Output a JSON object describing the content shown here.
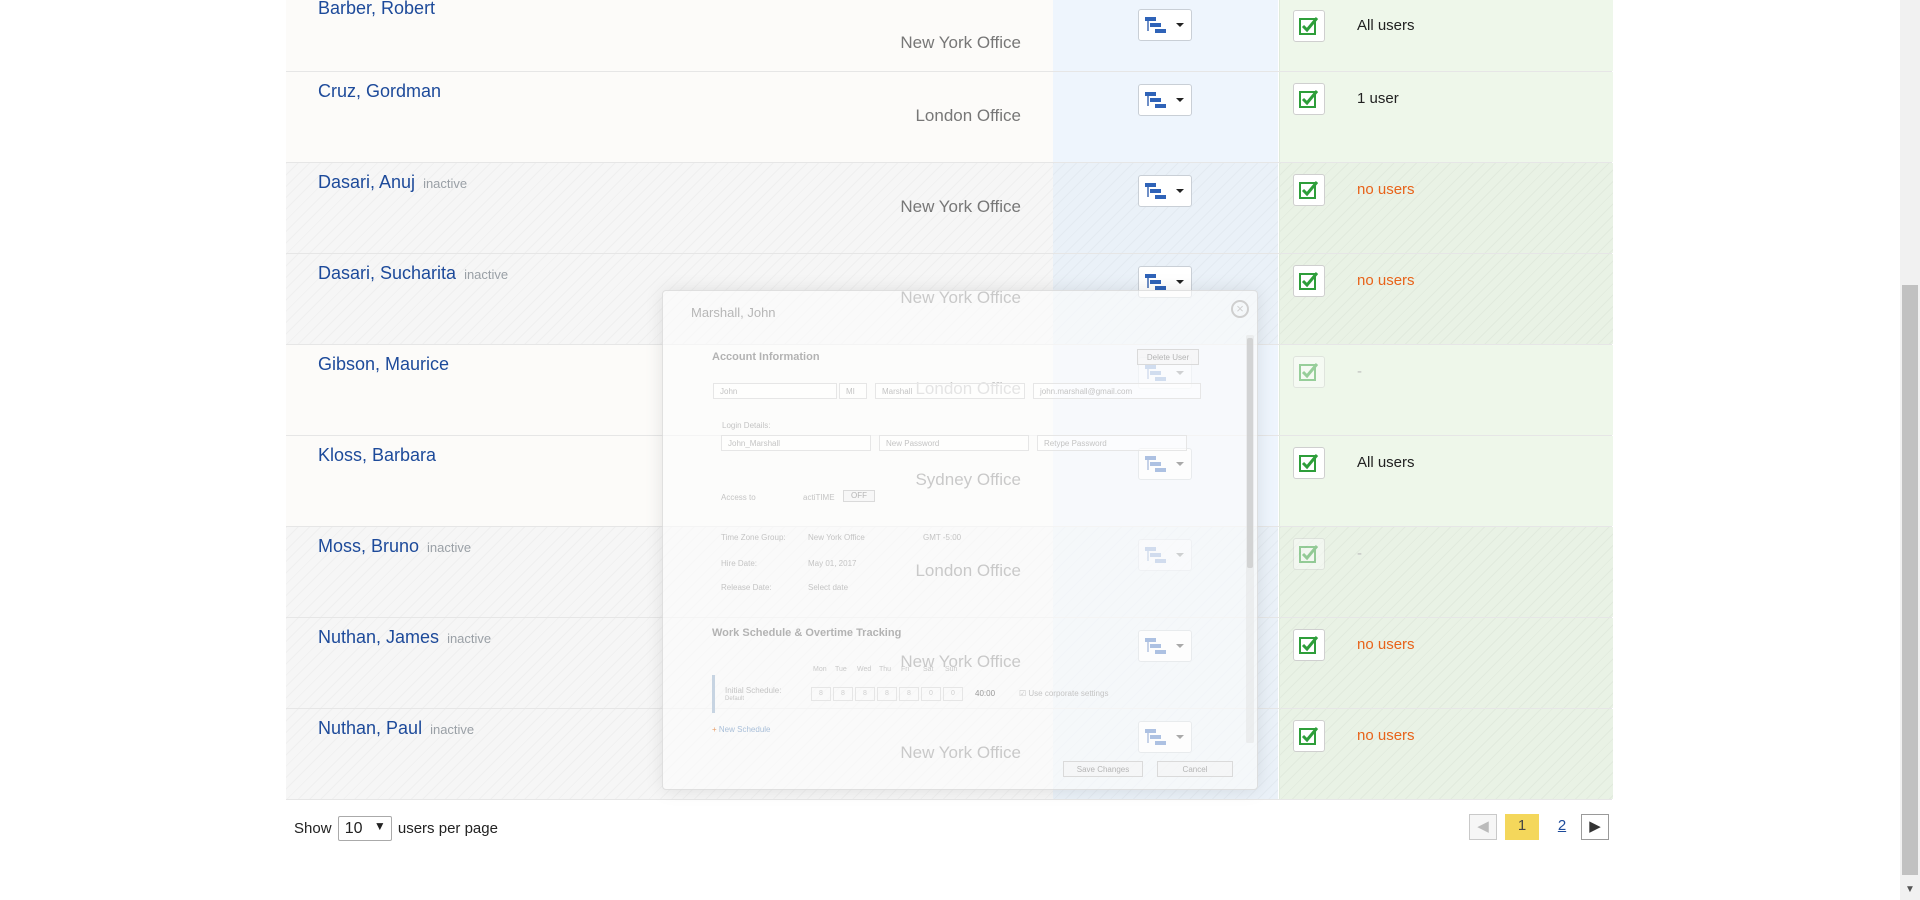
{
  "users": [
    {
      "name": "Barber, Robert",
      "status": "",
      "office": "New York Office",
      "access": "All users",
      "access_style": "normal",
      "checked": true
    },
    {
      "name": "Cruz, Gordman",
      "status": "",
      "office": "London Office",
      "access": "1 user",
      "access_style": "normal",
      "checked": true
    },
    {
      "name": "Dasari, Anuj",
      "status": "inactive",
      "office": "New York Office",
      "access": "no users",
      "access_style": "orange",
      "checked": true
    },
    {
      "name": "Dasari, Sucharita",
      "status": "inactive",
      "office": "New York Office",
      "access": "no users",
      "access_style": "orange",
      "checked": true
    },
    {
      "name": "Gibson, Maurice",
      "status": "",
      "office": "London Office",
      "access": "-",
      "access_style": "dash",
      "checked": false
    },
    {
      "name": "Kloss, Barbara",
      "status": "",
      "office": "Sydney Office",
      "access": "All users",
      "access_style": "normal",
      "checked": true
    },
    {
      "name": "Moss, Bruno",
      "status": "inactive",
      "office": "London Office",
      "access": "-",
      "access_style": "dash",
      "checked": false
    },
    {
      "name": "Nuthan, James",
      "status": "inactive",
      "office": "New York Office",
      "access": "no users",
      "access_style": "orange",
      "checked": true
    },
    {
      "name": "Nuthan, Paul",
      "status": "inactive",
      "office": "New York Office",
      "access": "no users",
      "access_style": "orange",
      "checked": true
    }
  ],
  "footer": {
    "show_label": "Show",
    "per_page_value": "10",
    "per_page_suffix": "users per page"
  },
  "pager": {
    "current": "1",
    "next_page": "2"
  },
  "modal": {
    "title": "Marshall, John",
    "account_section": "Account Information",
    "delete_label": "Delete User",
    "first_name": "John",
    "mi_placeholder": "MI",
    "last_name": "Marshall",
    "email": "john.marshall@gmail.com",
    "login_label": "Login Details:",
    "username": "John_Marshall",
    "new_password_placeholder": "New Password",
    "retype_password_placeholder": "Retype Password",
    "access_label": "Access to",
    "app_name": "actiTIME",
    "toggle_label": "OFF",
    "tz_label": "Time Zone Group:",
    "tz_value": "New York Office",
    "tz_offset": "GMT -5:00",
    "hire_label": "Hire Date:",
    "hire_value": "May 01, 2017",
    "release_label": "Release Date:",
    "release_value": "Select date",
    "schedule_section": "Work Schedule & Overtime Tracking",
    "days": [
      "Mon",
      "Tue",
      "Wed",
      "Thu",
      "Fri",
      "Sat",
      "Sun"
    ],
    "hours": [
      "8",
      "8",
      "8",
      "8",
      "8",
      "0",
      "0"
    ],
    "initial_label": "Initial Schedule:",
    "initial_sub": "Default",
    "total": "40:00",
    "corporate_label": "Use corporate settings",
    "new_schedule": "New Schedule",
    "save_label": "Save Changes",
    "cancel_label": "Cancel"
  },
  "colors": {
    "name_blue": "#1d4a9a",
    "orange": "#e8631a",
    "pager_current": "#f4d75b",
    "check_green": "#2e9e3a"
  }
}
